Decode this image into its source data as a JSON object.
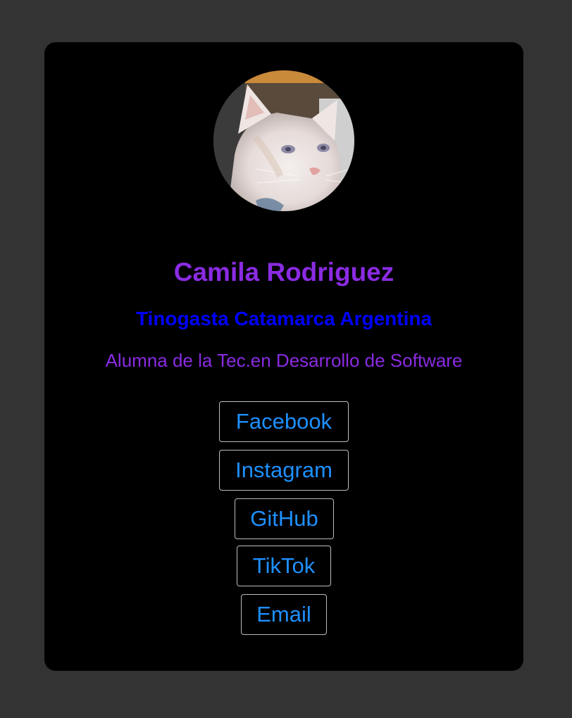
{
  "profile": {
    "avatar_alt": "cat-photo",
    "name": "Camila Rodriguez",
    "location": "Tinogasta Catamarca Argentina",
    "bio": "Alumna de la Tec.en Desarrollo de Software"
  },
  "links": {
    "facebook": "Facebook",
    "instagram": "Instagram",
    "github": "GitHub",
    "tiktok": "TikTok",
    "email": "Email"
  },
  "colors": {
    "page_background": "#333333",
    "card_background": "#000000",
    "name": "#8a2be2",
    "location": "#0000ff",
    "bio": "#8a2be2",
    "link_text": "#1e90ff",
    "link_border": "#bdbdbd"
  }
}
